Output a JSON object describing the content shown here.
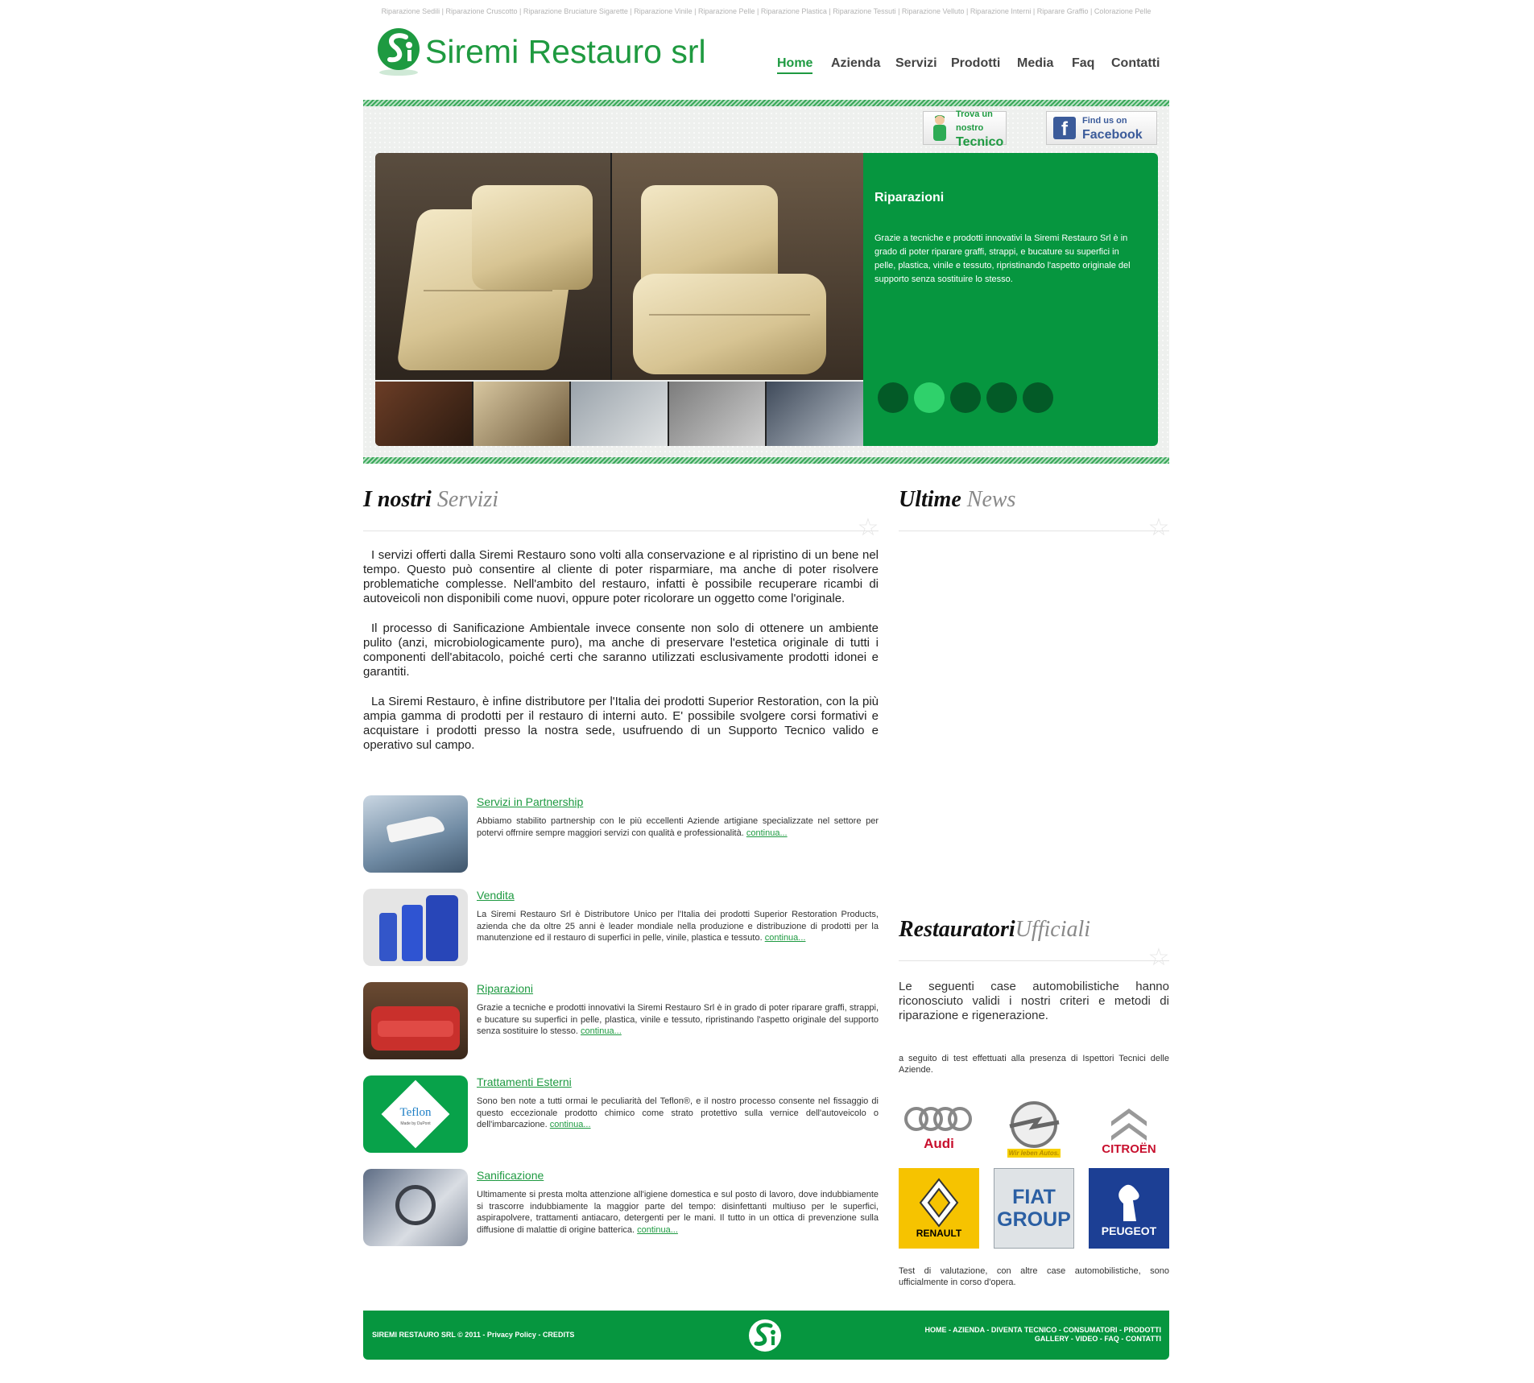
{
  "seo_line": "Riparazione Sedili | Riparazione Cruscotto | Riparazione Bruciature Sigarette | Riparazione Vinile | Riparazione Pelle | Riparazione Plastica | Riparazione Tessuti | Riparazione Velluto | Riparazione Interni | Riparare Graffio | Colorazione Pelle",
  "logo": {
    "text": "Siremi Restauro srl",
    "icon": "siremi-logo-icon"
  },
  "nav": [
    "Home",
    "Azienda",
    "Servizi",
    "Prodotti",
    "Media",
    "Faq",
    "Contatti"
  ],
  "nav_active": "Home",
  "banner_buttons": {
    "tecnico": {
      "line1": "Trova un nostro",
      "line2": "Tecnico",
      "icon": "technician-icon"
    },
    "facebook": {
      "line1": "Find us on",
      "line2": "Facebook",
      "icon": "facebook-icon"
    }
  },
  "slider": {
    "title": "Riparazioni",
    "text": "Grazie a tecniche e prodotti innovativi la Siremi Restauro Srl è in grado di poter riparare graffi, strappi, e bucature su superfici in pelle, plastica, vinile e tessuto, ripristinando l'aspetto originale del supporto senza sostituire lo stesso.",
    "dots": 5,
    "active_dot": 2
  },
  "services_section": {
    "title_bold": "I nostri",
    "title_light": "Servizi"
  },
  "intro_paragraphs": [
    "I servizi offerti dalla Siremi Restauro sono volti alla conservazione e al ripristino di un bene nel tempo. Questo può consentire al cliente di poter risparmiare, ma anche di poter risolvere problematiche complesse. Nell'ambito del restauro, infatti è possibile recuperare ricambi di autoveicoli non disponibili come nuovi, oppure poter ricolorare un oggetto come l'originale.",
    "Il processo di Sanificazione Ambientale invece consente non solo di ottenere un ambiente pulito (anzi, microbiologicamente puro), ma anche di preservare l'estetica originale di tutti i componenti dell'abitacolo, poiché certi che saranno utilizzati esclusivamente prodotti idonei e garantiti.",
    "La Siremi Restauro, è infine distributore per l'Italia dei prodotti Superior Restoration, con la più ampia gamma di prodotti per il restauro di interni auto. E' possibile svolgere corsi formativi e acquistare i prodotti presso la nostra sede, usufruendo di un Supporto Tecnico valido e operativo sul campo."
  ],
  "services": [
    {
      "title": "Servizi in Partnership",
      "desc": "Abbiamo stabilito partnership con le più eccellenti Aziende artigiane specializzate nel settore per potervi offrnire sempre maggiori servizi con qualità e professionalità.",
      "more": "continua..."
    },
    {
      "title": "Vendita",
      "desc": "La Siremi Restauro Srl è Distributore Unico per l'Italia dei prodotti Superior Restoration Products, azienda che da oltre 25 anni è leader mondiale nella produzione e distribuzione di prodotti per la manutenzione ed il restauro di superfici in pelle, vinile, plastica e tessuto.",
      "more": "continua..."
    },
    {
      "title": "Riparazioni",
      "desc": "Grazie a tecniche e prodotti innovativi la Siremi Restauro Srl è in grado di poter riparare graffi, strappi, e bucature su superfici in pelle, plastica, vinile e tessuto, ripristinando l'aspetto originale del supporto senza sostituire lo stesso.",
      "more": "continua..."
    },
    {
      "title": "Trattamenti Esterni",
      "desc": "Sono ben note a tutti ormai le peculiarità del Teflon®, e il nostro processo consente nel fissaggio di questo eccezionale prodotto chimico come strato protettivo sulla vernice dell'autoveicolo o dell'imbarcazione.",
      "more": "continua..."
    },
    {
      "title": "Sanificazione",
      "desc": "Ultimamente si presta molta attenzione all'igiene domestica e sul posto di lavoro, dove indubbiamente si trascorre indubbiamente la maggior parte del tempo: disinfettanti multiuso per le superfici, aspirapolvere, trattamenti antiacaro, detergenti per le mani. Il tutto in un ottica di prevenzione sulla diffusione di malattie di origine batterica.",
      "more": "continua..."
    }
  ],
  "teflon_thumb": {
    "brand": "Teflon",
    "sub": "Made by DuPont"
  },
  "news_section": {
    "title_bold": "Ultime",
    "title_light": "News"
  },
  "restauratori_section": {
    "title_bold": "Restauratori",
    "title_light": "Ufficiali",
    "text1": "Le seguenti case automobilistiche hanno riconosciuto validi i nostri criteri e metodi di riparazione e rigenerazione.",
    "text2": "a seguito di test effettuati alla presenza di Ispettori Tecnici delle Aziende.",
    "text3": "Test di valutazione, con altre case automobilistiche, sono ufficialmente in corso d'opera."
  },
  "brands": [
    {
      "name": "Audi",
      "icon": "audi-logo-icon"
    },
    {
      "name": "Wir leben Autos.",
      "icon": "opel-logo-icon"
    },
    {
      "name": "CITROËN",
      "icon": "citroen-logo-icon"
    },
    {
      "name": "RENAULT",
      "icon": "renault-logo-icon"
    },
    {
      "name": "FIAT GROUP",
      "line1": "FIAT",
      "line2": "GROUP",
      "icon": "fiat-group-logo-icon"
    },
    {
      "name": "PEUGEOT",
      "icon": "peugeot-logo-icon"
    }
  ],
  "footer": {
    "copyright": "SIREMI RESTAURO SRL © 2011 -",
    "privacy": "Privacy Policy",
    "sep": "-",
    "credits": "CREDITS",
    "links_row1": "HOME -  AZIENDA -  DIVENTA TECNICO -  CONSUMATORI -  PRODOTTI",
    "links_row2": "GALLERY -  VIDEO -  FAQ -  CONTATTI"
  },
  "colors": {
    "brand_green": "#06963f",
    "link_green": "#1e9a41",
    "active_dot": "#2fd16b",
    "dot": "#035a27"
  }
}
